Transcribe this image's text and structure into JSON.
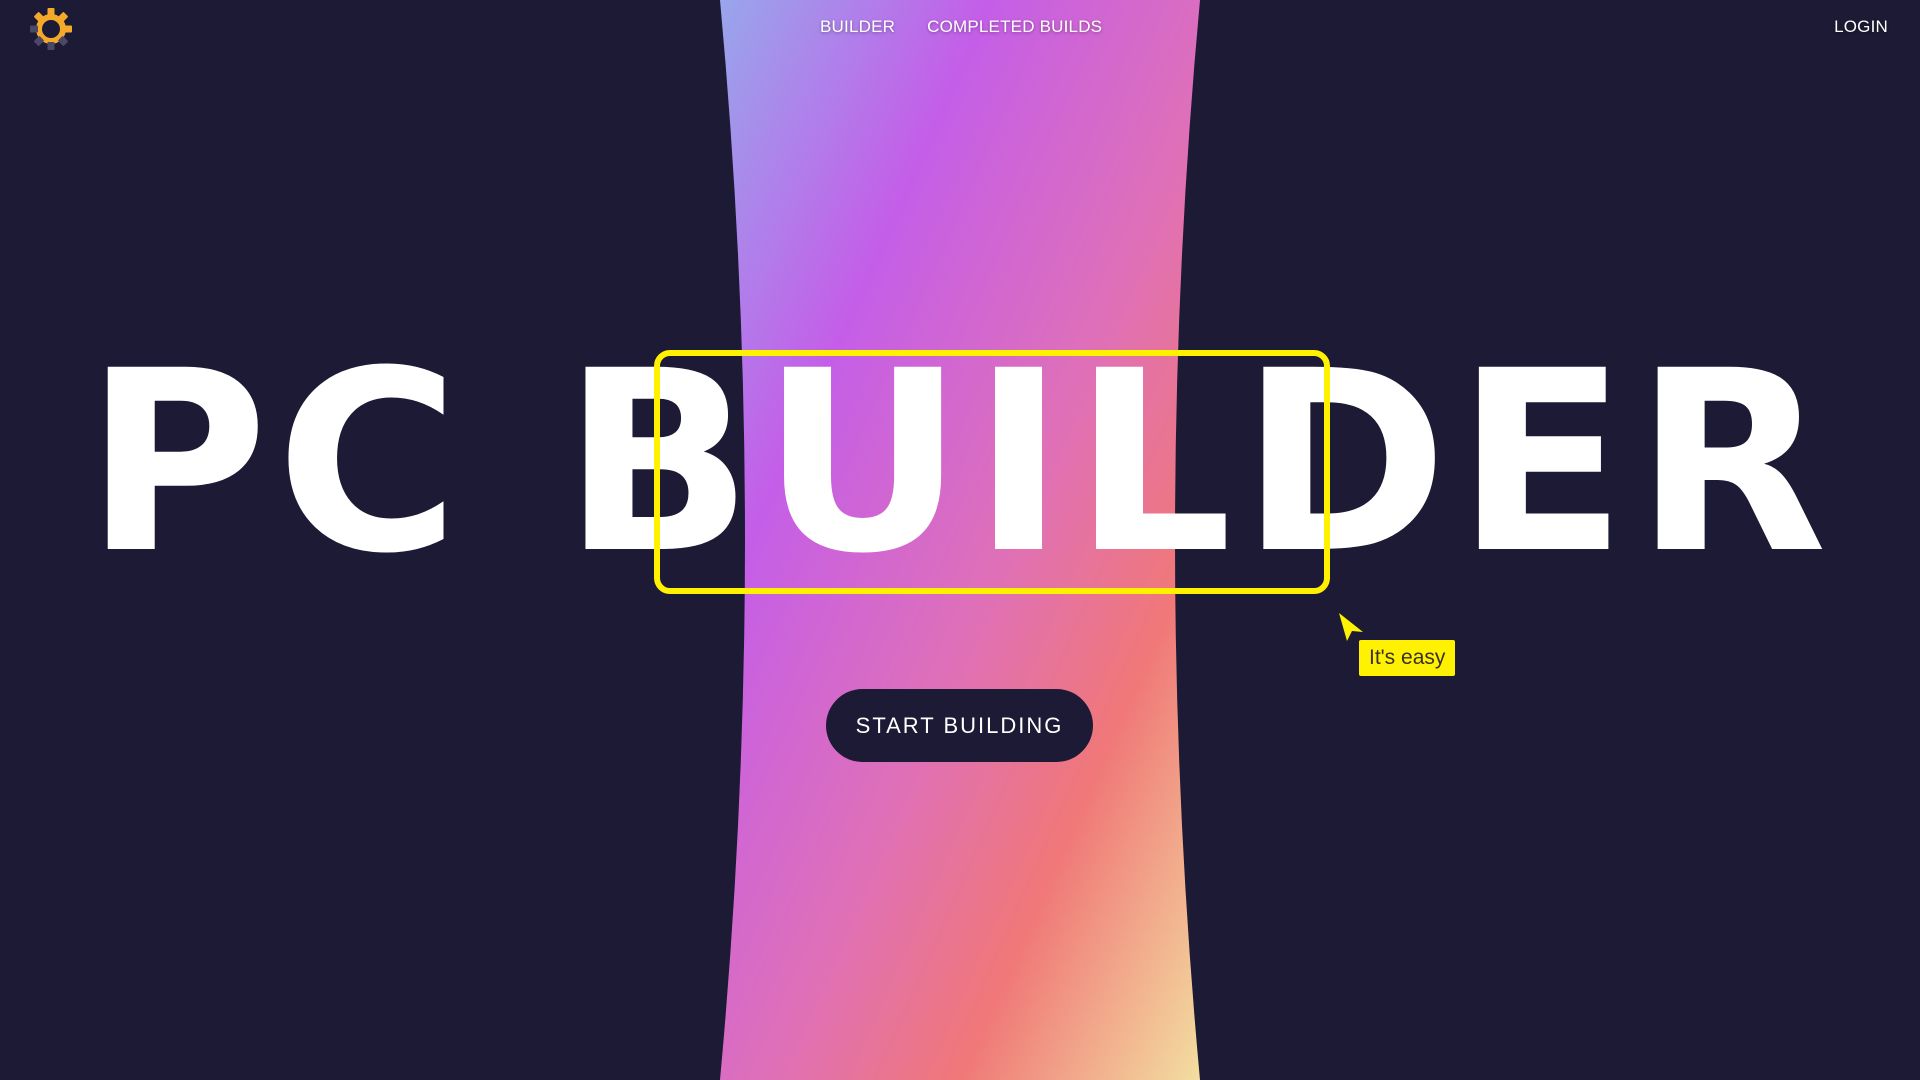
{
  "nav": {
    "logo_icon": "gear-icon",
    "items": [
      {
        "label": "BUILDER"
      },
      {
        "label": "COMPLETED BUILDS"
      }
    ],
    "login_label": "LOGIN"
  },
  "hero": {
    "title": "PC BUILDER",
    "highlight_word": "BUILD",
    "tooltip": "It's easy",
    "cta_label": "START BUILDING"
  },
  "colors": {
    "background": "#1d1a35",
    "highlight": "#fff200",
    "gradient_top_left": "#98a6ec",
    "gradient_mid": "#c45ee8",
    "gradient_warm": "#f07878",
    "gradient_bottom_right": "#f3dea0",
    "logo_gear": "#f4a92a"
  }
}
